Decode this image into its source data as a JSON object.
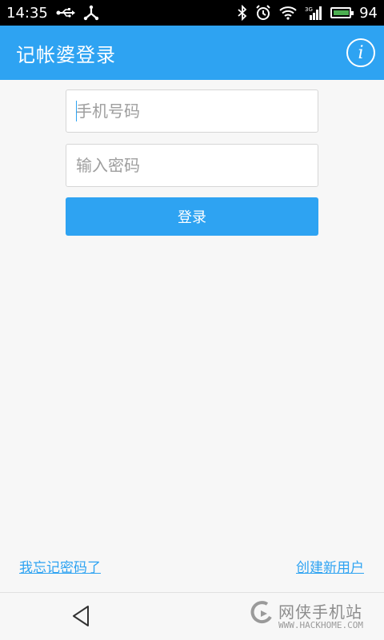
{
  "status_bar": {
    "time": "14:35",
    "battery_level": "94"
  },
  "app_bar": {
    "title": "记帐婆登录",
    "info_icon": "info-icon"
  },
  "form": {
    "phone_placeholder": "手机号码",
    "password_placeholder": "输入密码",
    "login_label": "登录"
  },
  "links": {
    "forgot_password": "我忘记密码了",
    "create_user": "创建新用户"
  },
  "watermark": {
    "name": "网侠手机站",
    "url": "WWW.HACKHOME.COM"
  },
  "colors": {
    "accent": "#2ea3f2",
    "background": "#f7f7f7"
  }
}
